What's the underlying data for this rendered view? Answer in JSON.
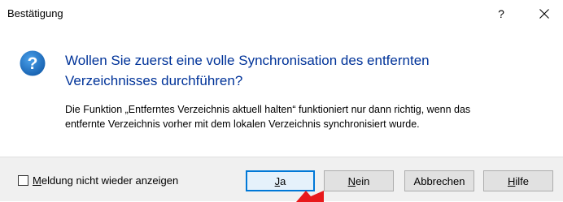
{
  "window": {
    "title": "Bestätigung",
    "help_glyph": "?",
    "close_icon": "close-icon"
  },
  "message": {
    "icon": "question-icon",
    "instruction_lines": [
      "Wollen Sie zuerst eine volle Synchronisation des entfernten",
      "Verzeichnisses durchführen?"
    ],
    "detail_lines": [
      "Die Funktion „Entferntes Verzeichnis aktuell halten“ funktioniert nur dann richtig, wenn das",
      "entfernte Verzeichnis vorher mit dem lokalen Verzeichnis synchronisiert wurde."
    ]
  },
  "footer": {
    "checkbox": {
      "label_mnemonic": "M",
      "label_rest": "eldung nicht wieder anzeigen",
      "checked": false
    },
    "buttons": {
      "yes": {
        "mnemonic": "J",
        "rest": "a"
      },
      "no": {
        "mnemonic": "N",
        "rest": "ein"
      },
      "cancel": {
        "label": "Abbrechen"
      },
      "help": {
        "mnemonic": "H",
        "rest": "ilfe"
      }
    }
  },
  "colors": {
    "instruction_text": "#003399",
    "question_icon": "#1f73c7",
    "footer_bg": "#f0f0f0",
    "default_button_border": "#0078d7",
    "pointer_arrow": "#e8191b"
  }
}
